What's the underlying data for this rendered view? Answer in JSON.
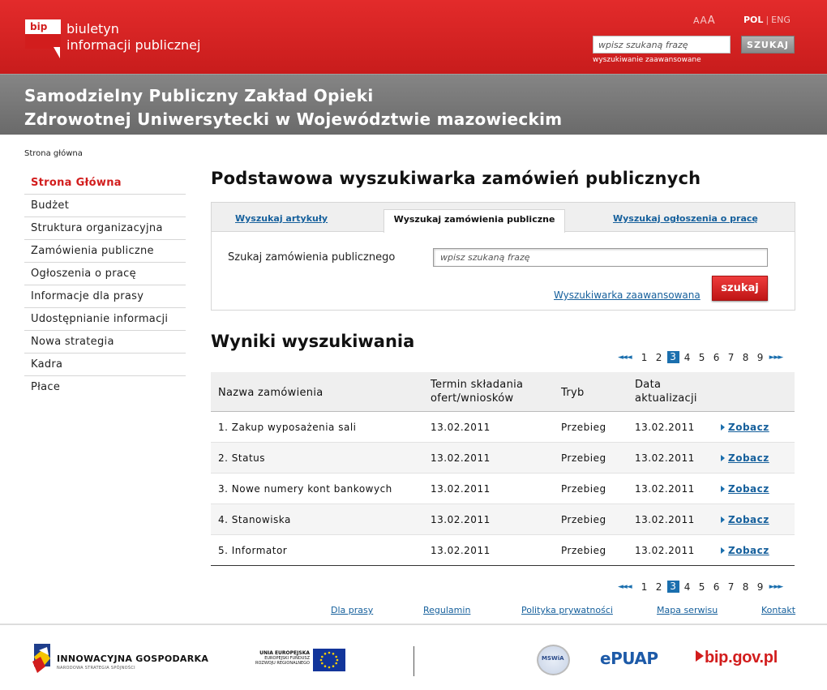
{
  "header": {
    "logo": {
      "abbr": "bip",
      "line1": "biuletyn",
      "line2": "informacji publicznej"
    },
    "font_sizes": [
      "A",
      "A",
      "A"
    ],
    "languages": {
      "active": "POL",
      "other": "ENG",
      "separator": "|"
    },
    "search": {
      "placeholder": "wpisz szukaną frazę",
      "button": "SZUKAJ",
      "advanced_link": "wyszukiwanie zaawansowane"
    }
  },
  "institution": {
    "line1": "Samodzielny Publiczny Zakład Opieki",
    "line2": "Zdrowotnej Uniwersytecki w Województwie mazowieckim"
  },
  "breadcrumb": "Strona główna",
  "sidebar": {
    "items": [
      {
        "label": "Strona Główna",
        "active": true
      },
      {
        "label": "Budżet"
      },
      {
        "label": "Struktura organizacyjna"
      },
      {
        "label": "Zamówienia publiczne"
      },
      {
        "label": "Ogłoszenia o pracę"
      },
      {
        "label": "Informacje dla prasy"
      },
      {
        "label": "Udostępnianie informacji"
      },
      {
        "label": "Nowa strategia"
      },
      {
        "label": "Kadra"
      },
      {
        "label": "Płace"
      }
    ]
  },
  "main": {
    "title": "Podstawowa wyszukiwarka zamówień publicznych",
    "tabs": [
      "Wyszukaj artykuły",
      "Wyszukaj zamówienia publiczne",
      "Wyszukaj ogłoszenia o pracę"
    ],
    "search_label": "Szukaj zamówienia publicznego",
    "search_placeholder": "wpisz szukaną frazę",
    "advanced_link": "Wyszukiwarka zaawansowana",
    "search_button": "szukaj",
    "results_title": "Wyniki wyszukiwania"
  },
  "pager": {
    "prev": "◄◄ ◄",
    "pages": [
      "1",
      "2",
      "3",
      "4",
      "5",
      "6",
      "7",
      "8",
      "9"
    ],
    "current": "3",
    "next": "► ►►"
  },
  "table": {
    "headers": {
      "name": "Nazwa zamówienia",
      "deadline_1": "Termin składania",
      "deadline_2": "ofert/wniosków",
      "mode": "Tryb",
      "updated_1": "Data",
      "updated_2": "aktualizacji"
    },
    "rows": [
      {
        "name": "1. Zakup wyposażenia sali",
        "deadline": "13.02.2011",
        "mode": "Przebieg",
        "updated": "13.02.2011",
        "link": "Zobacz"
      },
      {
        "name": "2. Status",
        "deadline": "13.02.2011",
        "mode": "Przebieg",
        "updated": "13.02.2011",
        "link": "Zobacz"
      },
      {
        "name": "3. Nowe numery kont bankowych",
        "deadline": "13.02.2011",
        "mode": "Przebieg",
        "updated": "13.02.2011",
        "link": "Zobacz"
      },
      {
        "name": "4. Stanowiska",
        "deadline": "13.02.2011",
        "mode": "Przebieg",
        "updated": "13.02.2011",
        "link": "Zobacz"
      },
      {
        "name": "5. Informator",
        "deadline": "13.02.2011",
        "mode": "Przebieg",
        "updated": "13.02.2011",
        "link": "Zobacz"
      }
    ]
  },
  "footer": {
    "links": [
      "Dla prasy",
      "Regulamin",
      "Polityka prywatności",
      "Mapa serwisu",
      "Kontakt"
    ],
    "logos": {
      "ig_title": "INNOWACYJNA GOSPODARKA",
      "ig_sub": "NARODOWA STRATEGIA SPÓJNOŚCI",
      "ue_1": "UNIA EUROPEJSKA",
      "ue_2": "EUROPEJSKI FUNDUSZ",
      "ue_3": "ROZWOJU REGIONALNEGO",
      "mswia": "MSWiA",
      "epuap": "ePUAP",
      "bipgov": "bip.gov.pl"
    }
  },
  "colors": {
    "brand_red": "#d21d1d",
    "link_blue": "#16609c",
    "title_gray": "#7a7a7a"
  }
}
